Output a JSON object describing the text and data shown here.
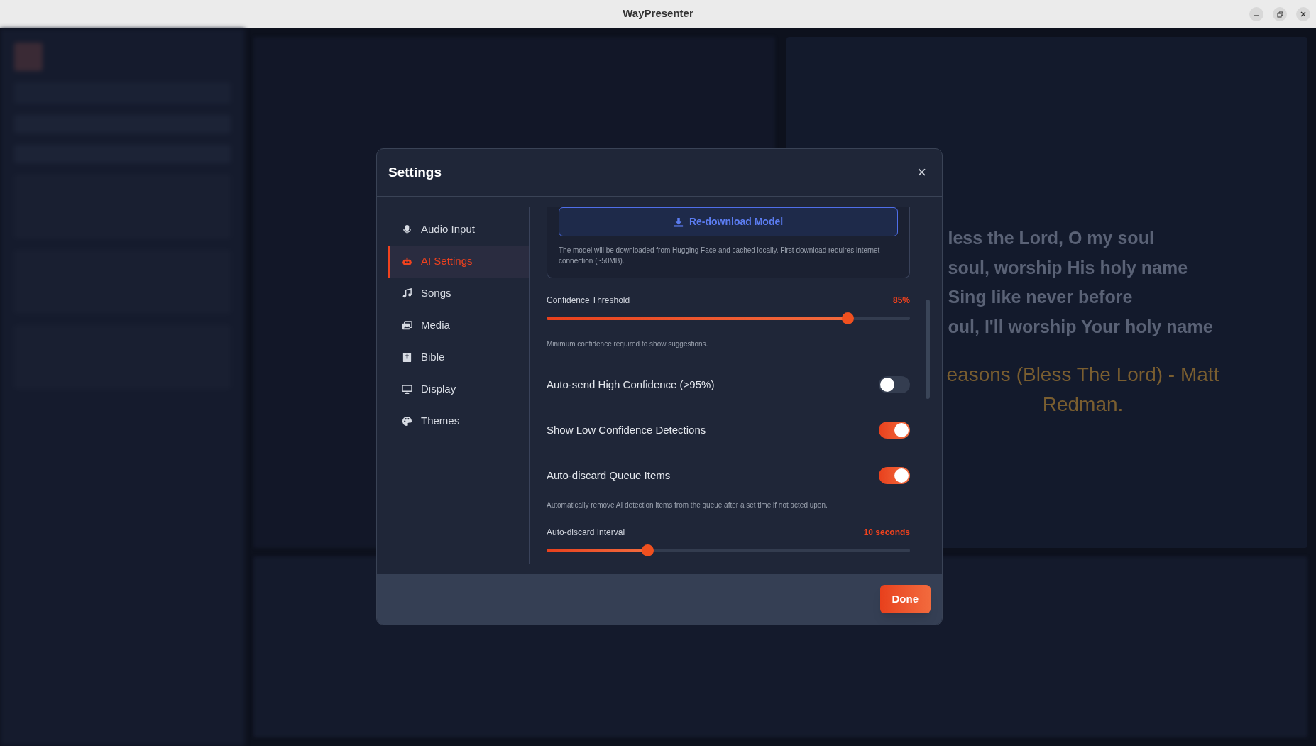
{
  "window": {
    "title": "WayPresenter"
  },
  "background": {
    "lyrics": [
      "less the Lord, O my soul",
      "soul, worship His holy name",
      "Sing like never before",
      "oul, I'll worship Your holy name"
    ],
    "song_title": [
      "easons (Bless The Lord) - Matt",
      "Redman."
    ]
  },
  "dialog": {
    "title": "Settings",
    "close": "×",
    "nav": [
      {
        "label": "Audio Input",
        "selected": false
      },
      {
        "label": "AI Settings",
        "selected": true
      },
      {
        "label": "Songs",
        "selected": false
      },
      {
        "label": "Media",
        "selected": false
      },
      {
        "label": "Bible",
        "selected": false
      },
      {
        "label": "Display",
        "selected": false
      },
      {
        "label": "Themes",
        "selected": false
      }
    ],
    "model": {
      "button": "Re-download Model",
      "note": "The model will be downloaded from Hugging Face and cached locally. First download requires internet connection (~50MB)."
    },
    "settings": [
      {
        "kind": "slider",
        "label": "Confidence Threshold",
        "value": "85%",
        "level": 0.84,
        "hint": "Minimum confidence required to show suggestions."
      },
      {
        "kind": "toggle",
        "label": "Auto-send High Confidence (>95%)",
        "on": false
      },
      {
        "kind": "toggle",
        "label": "Show Low Confidence Detections",
        "on": true
      },
      {
        "kind": "toggle",
        "label": "Auto-discard Queue Items",
        "on": true,
        "hint": "Automatically remove AI detection items from the queue after a set time if not acted upon."
      },
      {
        "kind": "slider",
        "label": "Auto-discard Interval",
        "value": "10 seconds",
        "level": 0.27
      }
    ],
    "done": "Done"
  }
}
